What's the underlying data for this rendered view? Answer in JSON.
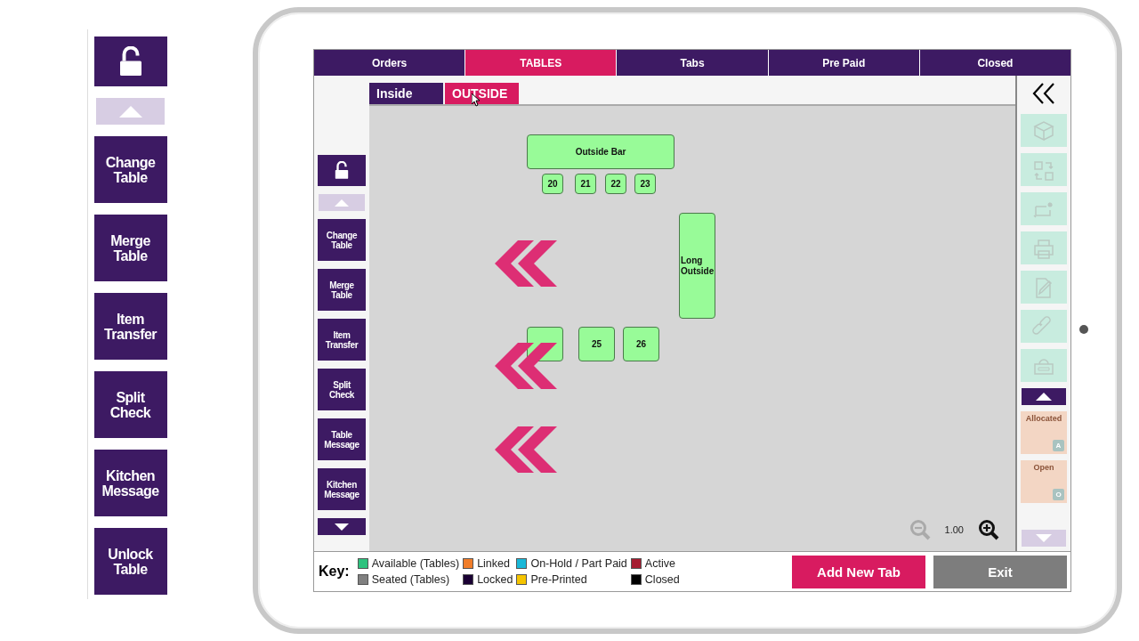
{
  "magnifier": {
    "buttons": [
      "Change Table",
      "Merge Table",
      "Item Transfer",
      "Split Check",
      "Kitchen Message",
      "Unlock Table"
    ]
  },
  "top_tabs": [
    {
      "label": "Orders",
      "selected": false
    },
    {
      "label": "TABLES",
      "selected": true
    },
    {
      "label": "Tabs",
      "selected": false
    },
    {
      "label": "Pre Paid",
      "selected": false
    },
    {
      "label": "Closed",
      "selected": false
    }
  ],
  "area_tabs": [
    {
      "label": "Inside",
      "selected": false
    },
    {
      "label": "OUTSIDE",
      "selected": true
    }
  ],
  "actions": [
    "Change Table",
    "Merge Table",
    "Item Transfer",
    "Split Check",
    "Table Message",
    "Kitchen Message"
  ],
  "floor": {
    "tables": [
      {
        "kind": "bar",
        "label": "Outside Bar"
      },
      {
        "kind": "small",
        "label": "20"
      },
      {
        "kind": "small",
        "label": "21"
      },
      {
        "kind": "small",
        "label": "22"
      },
      {
        "kind": "small",
        "label": "23"
      },
      {
        "kind": "long",
        "label": "Long Outside"
      },
      {
        "kind": "square"
      },
      {
        "kind": "square",
        "label": "25"
      },
      {
        "kind": "square",
        "label": "26"
      }
    ],
    "zoom_out": {
      "disabled": true
    },
    "zoom_value": "1.00",
    "zoom_in": {
      "disabled": false
    }
  },
  "tools": [
    {
      "kind": "box",
      "disabled": true
    },
    {
      "kind": "swap",
      "disabled": true
    },
    {
      "kind": "card",
      "disabled": true
    },
    {
      "kind": "printer",
      "disabled": true
    },
    {
      "kind": "edit",
      "disabled": true
    },
    {
      "kind": "link",
      "disabled": true
    },
    {
      "kind": "tag",
      "disabled": true
    }
  ],
  "queues": [
    {
      "label": "Allocated",
      "badge": "A"
    },
    {
      "label": "Open",
      "badge": "O"
    }
  ],
  "key": {
    "title": "Key:",
    "items": [
      {
        "label": "Available (Tables)",
        "color": "#2ec27e"
      },
      {
        "label": "Linked",
        "color": "#f07d2a"
      },
      {
        "label": "On-Hold / Part Paid",
        "color": "#1ab8d8"
      },
      {
        "label": "Active",
        "color": "#a51c30"
      },
      {
        "label": "Seated (Tables)",
        "color": "#808080"
      },
      {
        "label": "Locked",
        "color": "#1a0033"
      },
      {
        "label": "Pre-Printed",
        "color": "#f5c400"
      },
      {
        "label": "Closed",
        "color": "#000000"
      }
    ]
  },
  "buttons": [
    {
      "label": "Add New Tab",
      "kind": "primary"
    },
    {
      "label": "Exit",
      "kind": "secondary"
    }
  ]
}
